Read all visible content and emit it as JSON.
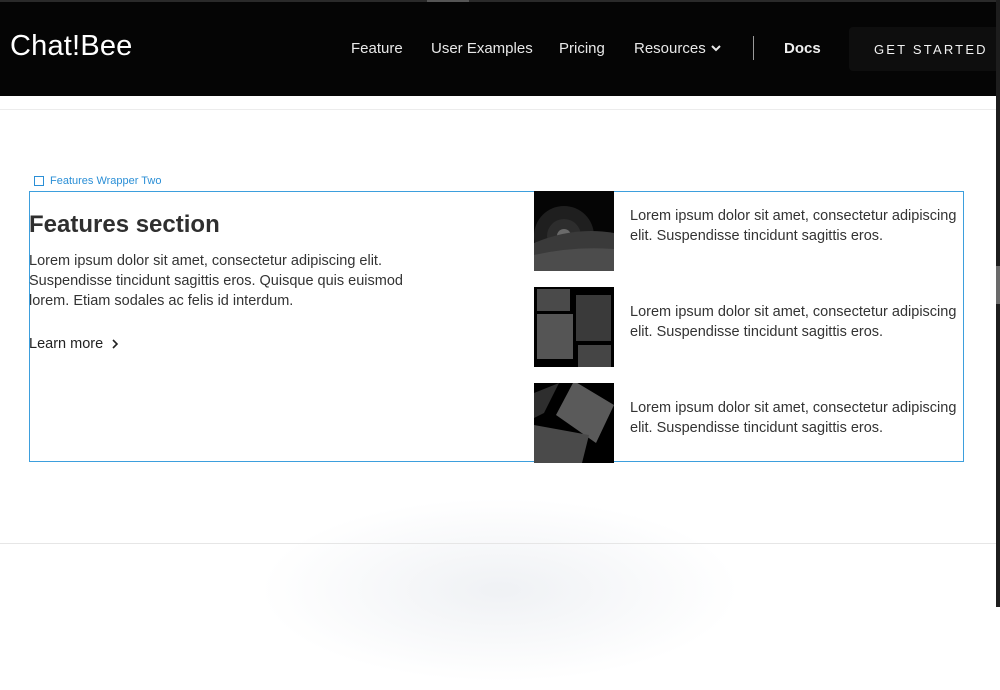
{
  "nav": {
    "brand": "Chat!Bee",
    "links": [
      "Feature",
      "User Examples",
      "Pricing",
      "Resources"
    ],
    "docs": "Docs",
    "cta": "GET STARTED"
  },
  "selection": {
    "label": "Features Wrapper Two"
  },
  "features": {
    "title": "Features section",
    "description": "Lorem ipsum dolor sit amet, consectetur adipiscing elit. Suspendisse tincidunt sagittis eros. Quisque quis euismod lorem. Etiam sodales ac felis id interdum.",
    "learn_more": "Learn more",
    "items": [
      {
        "text": "Lorem ipsum dolor sit amet, consectetur adipiscing elit. Suspendisse tincidunt sagittis eros.",
        "icon": "image-placeholder-icon"
      },
      {
        "text": "Lorem ipsum dolor sit amet, consectetur adipiscing elit. Suspendisse tincidunt sagittis eros.",
        "icon": "gallery-placeholder-icon"
      },
      {
        "text": "Lorem ipsum dolor sit amet, consectetur adipiscing elit. Suspendisse tincidunt sagittis eros.",
        "icon": "photos-placeholder-icon"
      }
    ]
  },
  "colors": {
    "nav_bg": "#050505",
    "selection": "#3d9fdd"
  }
}
